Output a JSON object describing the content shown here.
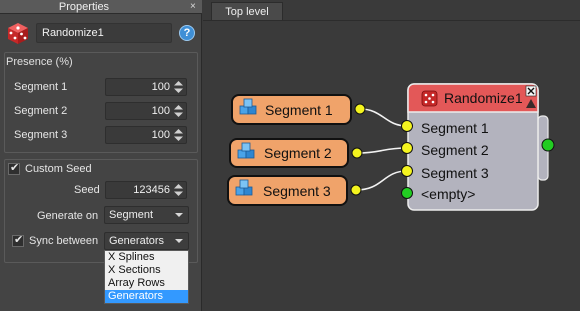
{
  "panel": {
    "title": "Properties",
    "close_glyph": "×",
    "object_name": "Randomize1",
    "help_glyph": "?",
    "icon": "dice-icon"
  },
  "presence": {
    "label": "Presence (%)",
    "rows": [
      {
        "label": "Segment 1",
        "value": "100"
      },
      {
        "label": "Segment 2",
        "value": "100"
      },
      {
        "label": "Segment 3",
        "value": "100"
      }
    ]
  },
  "custom_seed": {
    "checkbox_label": "Custom Seed",
    "checked": true,
    "seed_label": "Seed",
    "seed_value": "123456",
    "generate_on_label": "Generate on",
    "generate_on_value": "Segment",
    "sync_label": "Sync between",
    "sync_checked": true,
    "sync_value": "Generators",
    "sync_options": [
      "X Splines",
      "X Sections",
      "Array Rows",
      "Generators"
    ],
    "sync_selected_index": 3
  },
  "editor": {
    "tab": "Top level",
    "source_nodes": [
      "Segment 1",
      "Segment 2",
      "Segment 3"
    ],
    "randomize_node": {
      "title": "Randomize1",
      "inputs": [
        "Segment 1",
        "Segment 2",
        "Segment 3",
        "<empty>"
      ]
    }
  },
  "colors": {
    "source_node_fill": "#f0a36a",
    "randomize_header": "#e35858",
    "randomize_body": "#b3b3be",
    "port_yellow": "#f4f41e",
    "port_green": "#22cc22",
    "selection_blue": "#3399ff"
  }
}
